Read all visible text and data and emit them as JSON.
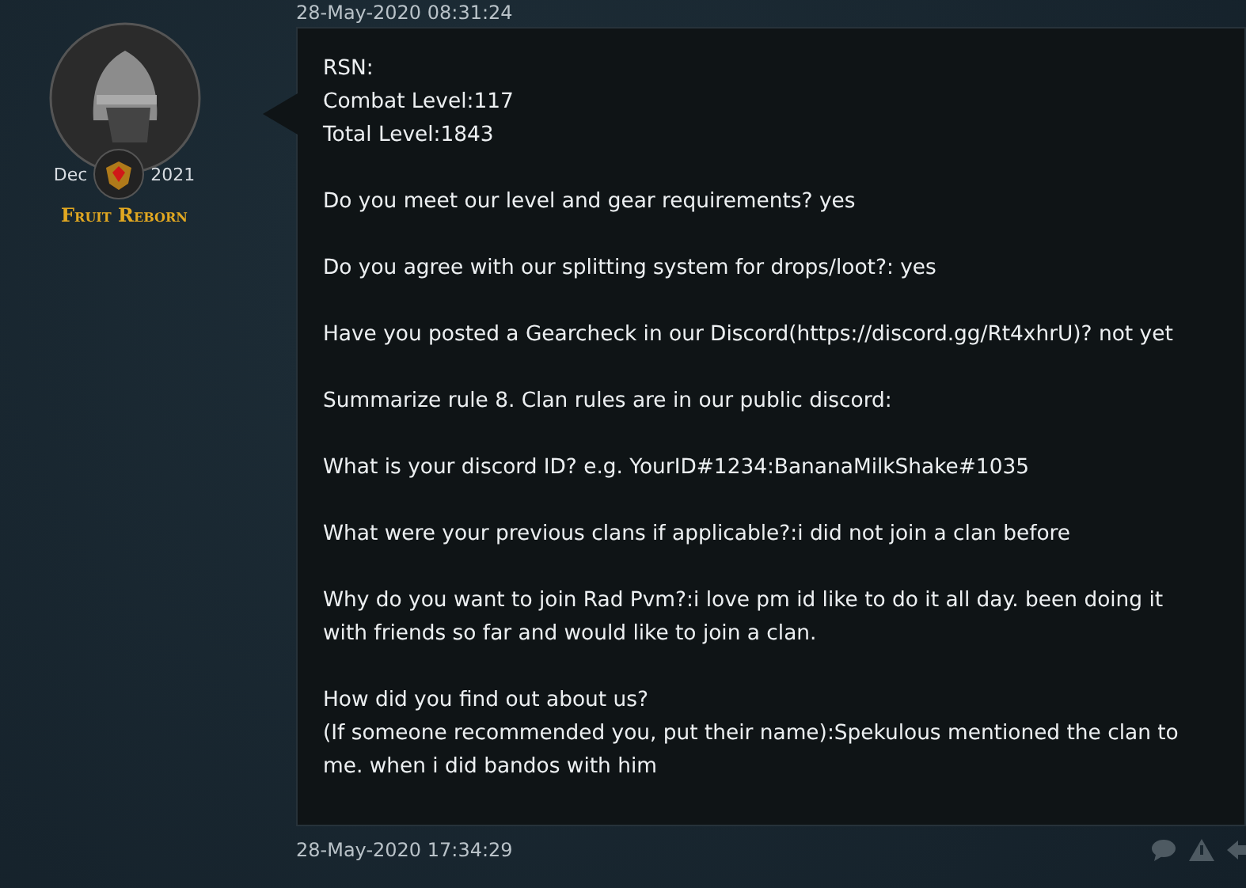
{
  "post_top_timestamp": "28-May-2020 08:31:24",
  "author": {
    "joined_month": "Dec",
    "joined_year": "2021",
    "name": "Fruit Reborn"
  },
  "post_body": [
    [
      "RSN:",
      "Combat Level:117",
      "Total Level:1843"
    ],
    [
      "Do you meet our level and gear requirements? yes"
    ],
    [
      "Do you agree with our splitting system for drops/loot?: yes"
    ],
    [
      "Have you posted a Gearcheck in our Discord(https://discord.gg/Rt4xhrU)? not yet"
    ],
    [
      "Summarize rule 8. Clan rules are in our public discord:"
    ],
    [
      "What is your discord ID? e.g. YourID#1234:BananaMilkShake#1035"
    ],
    [
      "What were your previous clans if applicable?:i did not join a clan before"
    ],
    [
      "Why do you want to join Rad Pvm?:i love pm id like to do it all day. been doing it with friends so far and would like to join a clan."
    ],
    [
      "How did you find out about us?",
      "(If someone recommended you, put their name):Spekulous mentioned the clan to me. when i did bandos with him"
    ]
  ],
  "next_post_timestamp": "28-May-2020 17:34:29"
}
